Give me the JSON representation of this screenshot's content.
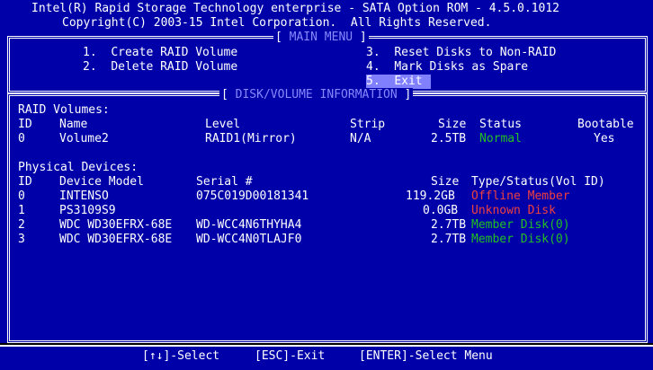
{
  "header": {
    "title": "Intel(R) Rapid Storage Technology enterprise - SATA Option ROM - 4.5.0.1012",
    "copyright": "Copyright(C) 2003-15 Intel Corporation.  All Rights Reserved."
  },
  "main_menu": {
    "title": "MAIN MENU",
    "items": [
      {
        "num": "1.",
        "label": "Create RAID Volume"
      },
      {
        "num": "2.",
        "label": "Delete RAID Volume"
      },
      {
        "num": "3.",
        "label": "Reset Disks to Non-RAID"
      },
      {
        "num": "4.",
        "label": "Mark Disks as Spare"
      },
      {
        "num": "5.",
        "label": "Exit"
      }
    ]
  },
  "info": {
    "title": "DISK/VOLUME INFORMATION",
    "raid_heading": "RAID Volumes:",
    "raid_columns": {
      "id": "ID",
      "name": "Name",
      "level": "Level",
      "strip": "Strip",
      "size": "Size",
      "status": "Status",
      "bootable": "Bootable"
    },
    "raid_rows": [
      {
        "id": "0",
        "name": "Volume2",
        "level": "RAID1(Mirror)",
        "strip": "N/A",
        "size": "2.5TB",
        "status": "Normal",
        "bootable": "Yes"
      }
    ],
    "physical_heading": "Physical Devices:",
    "physical_columns": {
      "id": "ID",
      "model": "Device Model",
      "serial": "Serial #",
      "size": "Size",
      "type_status": "Type/Status(Vol ID)"
    },
    "physical_rows": [
      {
        "id": "0",
        "model": "INTENSO",
        "serial": "075C019D00181341",
        "size": "119.2GB",
        "status": "Offline Member"
      },
      {
        "id": "1",
        "model": "PS3109S9",
        "serial": "",
        "size": "0.0GB",
        "status": "Unknown Disk"
      },
      {
        "id": "2",
        "model": "WDC WD30EFRX-68E",
        "serial": "WD-WCC4N6THYHA4",
        "size": "2.7TB",
        "status": "Member Disk(0)"
      },
      {
        "id": "3",
        "model": "WDC WD30EFRX-68E",
        "serial": "WD-WCC4N0TLAJF0",
        "size": "2.7TB",
        "status": "Member Disk(0)"
      }
    ]
  },
  "footer": {
    "select": "[↑↓]-Select",
    "exit": "[ESC]-Exit",
    "enter": "[ENTER]-Select Menu"
  },
  "colors": {
    "background": "#0000a8",
    "text": "#ffffff",
    "status_ok": "#22c022",
    "status_bad": "#f04040",
    "selection": "#8080ff"
  }
}
